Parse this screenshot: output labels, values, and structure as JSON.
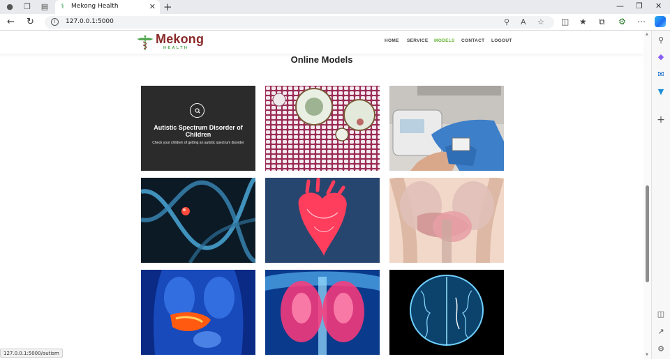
{
  "browser": {
    "tab_title": "Mekong Health",
    "url": "127.0.0.1:5000",
    "status_url": "127.0.0.1:5000/autism"
  },
  "site": {
    "brand": "Mekong",
    "brand_sub": "HEALTH",
    "nav": [
      "HOME",
      "SERVICE",
      "MODELS",
      "CONTACT",
      "LOGOUT"
    ],
    "active_nav": "MODELS",
    "accent_color": "#67b437",
    "brand_color": "#8a2a2a"
  },
  "main": {
    "title": "Online Models",
    "cards": [
      {
        "title": "Autistic Spectrum Disorder of Children",
        "description": "Check your children of getting an autistic spectrum disorder",
        "image": "search-overlay"
      },
      {
        "image": "cell-microscopy"
      },
      {
        "image": "glucose-meter-hands"
      },
      {
        "image": "dna-helix"
      },
      {
        "image": "heart-anatomy"
      },
      {
        "image": "abdomen-anatomy"
      },
      {
        "image": "liver-xray"
      },
      {
        "image": "lungs-xray"
      },
      {
        "image": "brain-xray"
      }
    ]
  }
}
